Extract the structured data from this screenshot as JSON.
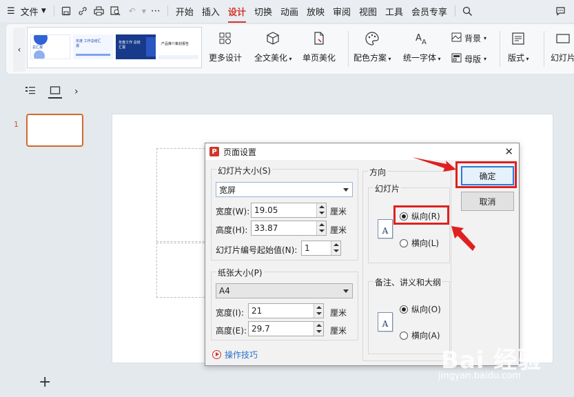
{
  "menubar": {
    "file_label": "文件",
    "tabs": [
      "开始",
      "插入",
      "设计",
      "切换",
      "动画",
      "放映",
      "审阅",
      "视图",
      "工具",
      "会员专享"
    ],
    "active_tab": "设计"
  },
  "ribbon": {
    "thumbs": [
      "总汇报",
      "年度 工作总结汇报",
      "年度工作 总结汇报",
      "产品推介策划报告"
    ],
    "more_design": "更多设计",
    "full_beautify": "全文美化",
    "single_beautify": "单页美化",
    "color_scheme": "配色方案",
    "unify_font": "统一字体",
    "background": "背景",
    "master": "母版",
    "layout": "版式",
    "slide_size": "幻灯片"
  },
  "left_panel": {
    "slide_number": "1"
  },
  "dialog": {
    "title": "页面设置",
    "slide_size_group": "幻灯片大小(S)",
    "slide_size_value": "宽屏",
    "width_label": "宽度(W):",
    "width_value": "19.05",
    "height_label": "高度(H):",
    "height_value": "33.87",
    "unit": "厘米",
    "start_num_label": "幻灯片编号起始值(N):",
    "start_num_value": "1",
    "paper_group": "纸张大小(P)",
    "paper_value": "A4",
    "paper_width_label": "宽度(I):",
    "paper_width_value": "21",
    "paper_height_label": "高度(E):",
    "paper_height_value": "29.7",
    "orientation_group": "方向",
    "slides_sub": "幻灯片",
    "portrait": "纵向(R)",
    "landscape": "横向(L)",
    "notes_sub": "备注、讲义和大纲",
    "notes_portrait": "纵向(O)",
    "notes_landscape": "横向(A)",
    "ok": "确定",
    "cancel": "取消",
    "tips": "操作技巧",
    "icon_letter": "A"
  },
  "watermark": {
    "line1": "Bai 经验",
    "line2": "jingyan.baidu.com"
  },
  "colors": {
    "accent": "#d0362a",
    "highlight": "#e02020"
  }
}
